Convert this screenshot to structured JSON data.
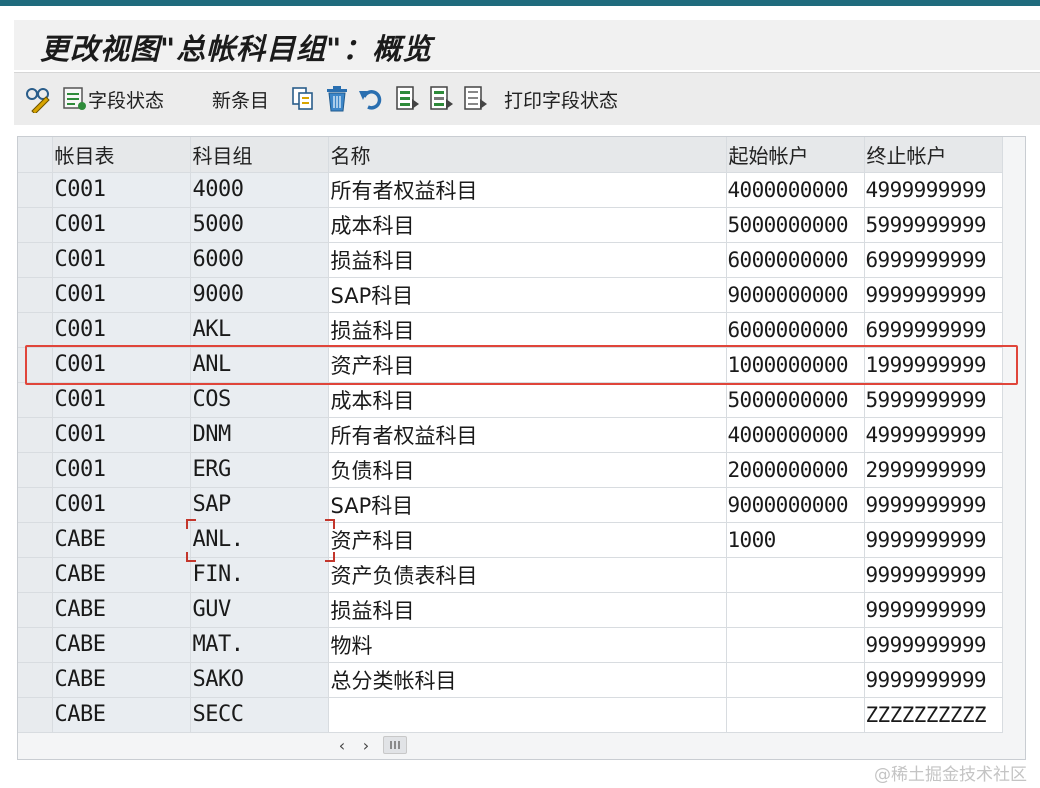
{
  "title": "更改视图\"总帐科目组\"：概览",
  "toolbar": {
    "field_status_label": "字段状态",
    "new_entries_label": "新条目",
    "print_field_status_label": "打印字段状态"
  },
  "table": {
    "headers": {
      "chart_of_accounts": "帐目表",
      "account_group": "科目组",
      "name": "名称",
      "from_account": "起始帐户",
      "to_account": "终止帐户"
    },
    "rows": [
      {
        "coa": "C001",
        "group": "4000",
        "name": "所有者权益科目",
        "from": "4000000000",
        "to": "4999999999"
      },
      {
        "coa": "C001",
        "group": "5000",
        "name": "成本科目",
        "from": "5000000000",
        "to": "5999999999"
      },
      {
        "coa": "C001",
        "group": "6000",
        "name": "损益科目",
        "from": "6000000000",
        "to": "6999999999"
      },
      {
        "coa": "C001",
        "group": "9000",
        "name": "SAP科目",
        "from": "9000000000",
        "to": "9999999999"
      },
      {
        "coa": "C001",
        "group": "AKL",
        "name": "损益科目",
        "from": "6000000000",
        "to": "6999999999"
      },
      {
        "coa": "C001",
        "group": "ANL",
        "name": "资产科目",
        "from": "1000000000",
        "to": "1999999999"
      },
      {
        "coa": "C001",
        "group": "COS",
        "name": "成本科目",
        "from": "5000000000",
        "to": "5999999999"
      },
      {
        "coa": "C001",
        "group": "DNM",
        "name": "所有者权益科目",
        "from": "4000000000",
        "to": "4999999999"
      },
      {
        "coa": "C001",
        "group": "ERG",
        "name": "负债科目",
        "from": "2000000000",
        "to": "2999999999"
      },
      {
        "coa": "C001",
        "group": "SAP",
        "name": "SAP科目",
        "from": "9000000000",
        "to": "9999999999"
      },
      {
        "coa": "CABE",
        "group": "ANL.",
        "name": "资产科目",
        "from": "1000",
        "to": "9999999999"
      },
      {
        "coa": "CABE",
        "group": "FIN.",
        "name": "资产负债表科目",
        "from": "",
        "to": "9999999999"
      },
      {
        "coa": "CABE",
        "group": "GUV",
        "name": "损益科目",
        "from": "",
        "to": "9999999999"
      },
      {
        "coa": "CABE",
        "group": "MAT.",
        "name": "物料",
        "from": "",
        "to": "9999999999"
      },
      {
        "coa": "CABE",
        "group": "SAKO",
        "name": "总分类帐科目",
        "from": "",
        "to": "9999999999"
      },
      {
        "coa": "CABE",
        "group": "SECC",
        "name": "",
        "from": "",
        "to": "ZZZZZZZZZZ"
      }
    ]
  },
  "highlighted_row": 5,
  "focused_cell": {
    "row": 10,
    "column": "group"
  },
  "colors": {
    "highlight_border": "#e0453a",
    "header_bg": "#e6e8ea",
    "key_cell_bg": "#e9edf1"
  },
  "watermark": "@稀土掘金技术社区"
}
